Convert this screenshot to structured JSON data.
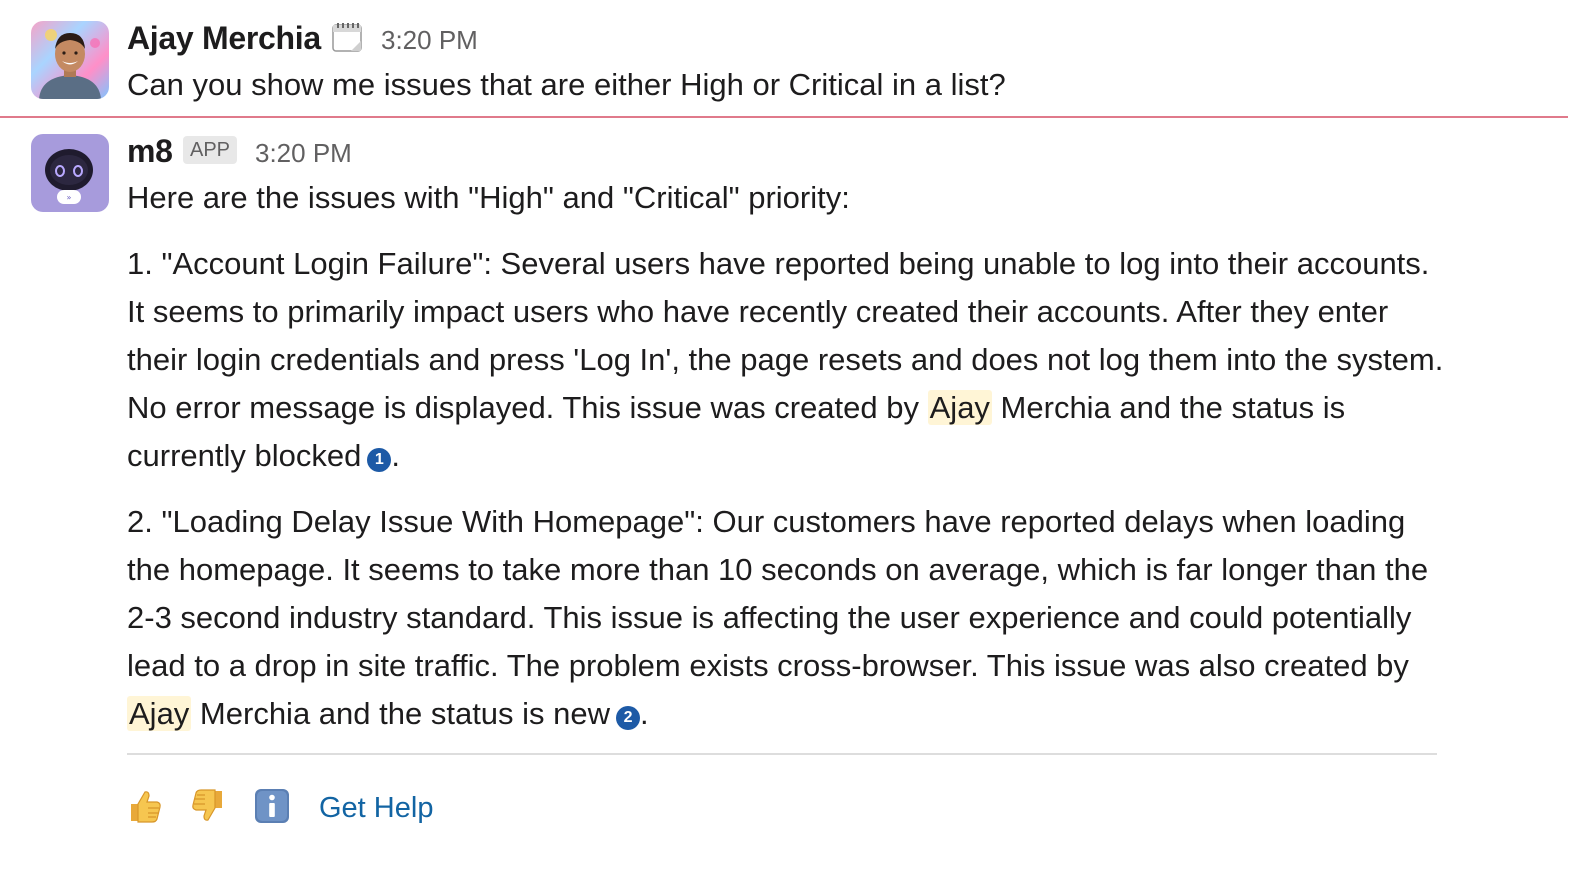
{
  "user_message": {
    "author": "Ajay Merchia",
    "status_icon": "calendar-icon",
    "time": "3:20 PM",
    "text": "Can you show me issues that are either High or Critical in a list?"
  },
  "bot_message": {
    "author": "m8",
    "badge": "APP",
    "time": "3:20 PM",
    "intro": "Here are the issues with \"High\" and \"Critical\" priority:",
    "item1": {
      "text_before": "1. \"Account Login Failure\": Several users have reported being unable to log into their accounts. It seems to primarily impact users who have recently created their accounts. After they enter their login credentials and press 'Log In', the page resets and does not log them into the system. No error message is displayed. This issue was created by ",
      "mention": "Ajay",
      "text_after": " Merchia and the status is currently blocked",
      "ref": "1",
      "end": "."
    },
    "item2": {
      "text_before": "2. \"Loading Delay Issue With Homepage\": Our customers have reported delays when loading the homepage. It seems to take more than 10 seconds on average, which is far longer than the 2-3 second industry standard. This issue is affecting the user experience and could potentially lead to a drop in site traffic. The problem exists cross-browser. This issue was also created by ",
      "mention": "Ajay",
      "text_after": " Merchia and the status is new",
      "ref": "2",
      "end": "."
    }
  },
  "actions": {
    "thumbs_up": "thumbs-up-icon",
    "thumbs_down": "thumbs-down-icon",
    "info": "info-icon",
    "help_label": "Get Help"
  },
  "colors": {
    "divider_new": "#e07a8b",
    "link": "#1264a3",
    "mention_bg": "#fff5d6",
    "ref_badge": "#1d5aa6"
  }
}
